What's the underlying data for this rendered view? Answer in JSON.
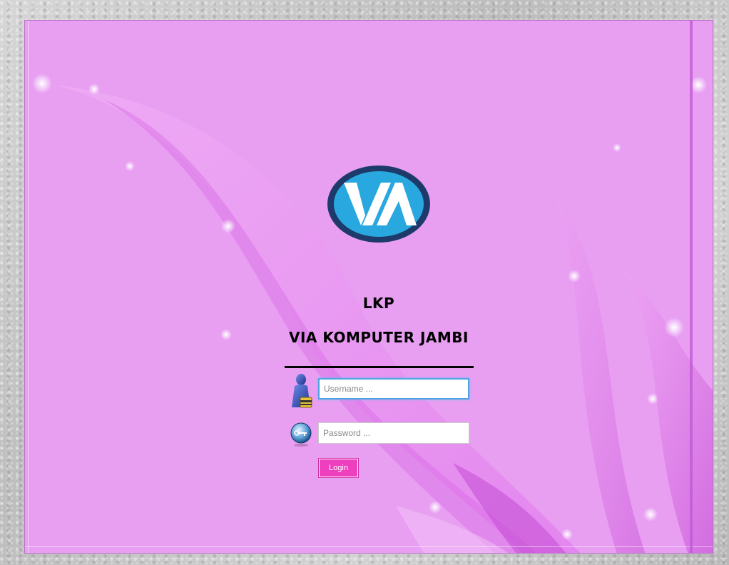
{
  "header": {
    "line1": "LKP",
    "line2": "VIA KOMPUTER JAMBI"
  },
  "logo": {
    "text": "VIA",
    "ring_color": "#1e3a6b",
    "fill_color": "#29a8e0"
  },
  "form": {
    "username": {
      "placeholder": "Username ...",
      "value": ""
    },
    "password": {
      "placeholder": "Password ...",
      "value": ""
    },
    "login_label": "Login"
  },
  "icons": {
    "user": "user-icon",
    "key": "key-icon"
  },
  "colors": {
    "background": "#e89ff2",
    "accent": "#ee3fbf"
  }
}
